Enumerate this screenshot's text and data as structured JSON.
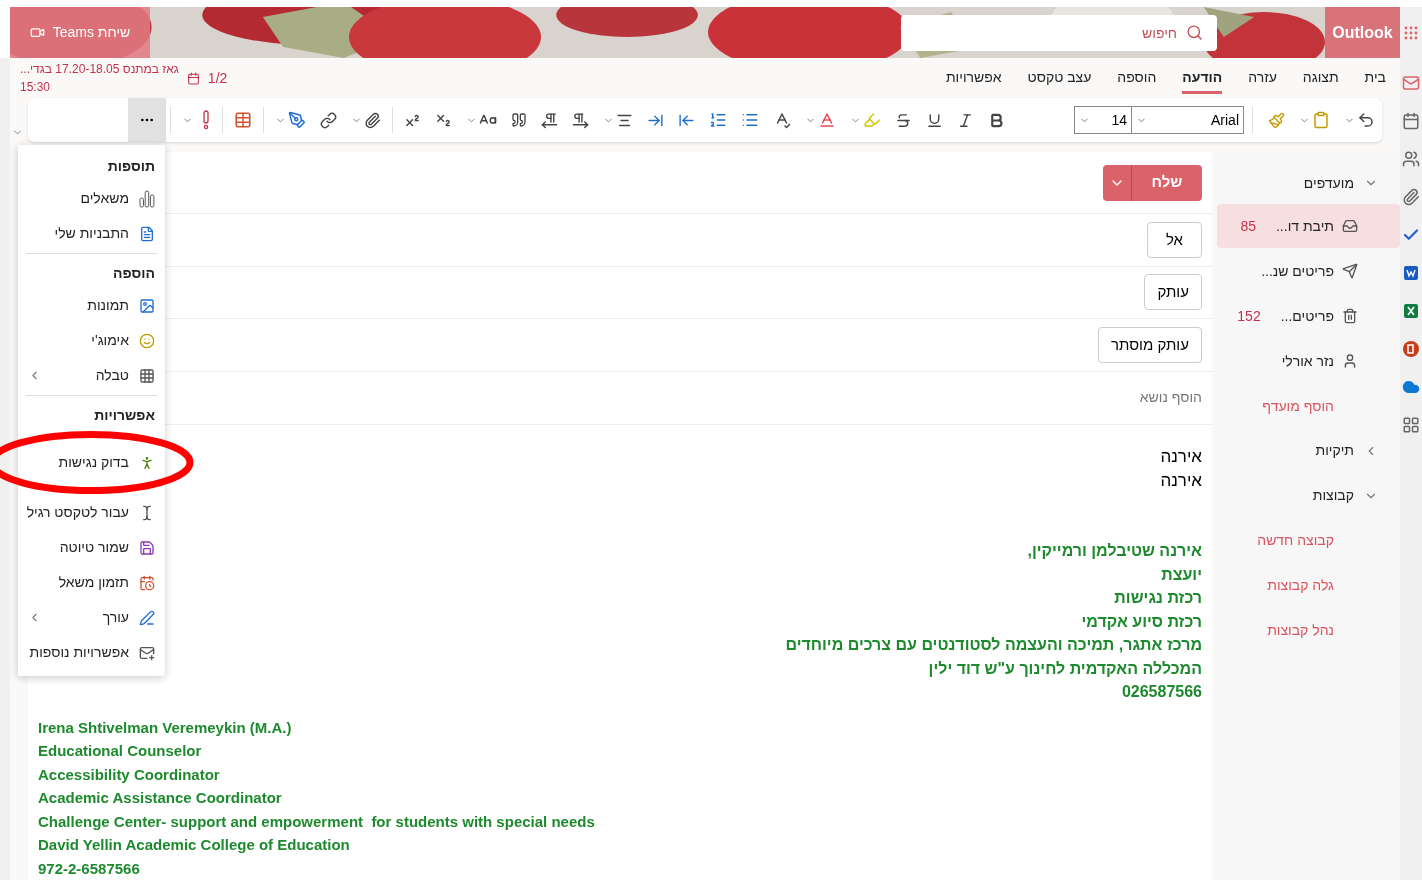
{
  "header": {
    "teams_button": {
      "label": "שיחת Teams"
    },
    "search": {
      "placeholder": "חיפוש"
    },
    "app_name": "Outlook"
  },
  "reminder": {
    "title": "גאז במתנס 17.20-18.05 בגדי...",
    "time": "15:30",
    "count": "1/2"
  },
  "tabs": [
    {
      "label": "בית",
      "selected": false
    },
    {
      "label": "תצוגה",
      "selected": false
    },
    {
      "label": "עזרה",
      "selected": false
    },
    {
      "label": "הודעה",
      "selected": true
    },
    {
      "label": "הוספה",
      "selected": false
    },
    {
      "label": "עצב טקסט",
      "selected": false
    },
    {
      "label": "אפשרויות",
      "selected": false
    }
  ],
  "toolbar": {
    "font": "Arial",
    "size": "14",
    "more_expanded": true
  },
  "menu": [
    {
      "title": "תוספות",
      "items": [
        {
          "label": "משאלים",
          "submenu": false
        },
        {
          "label": "התבניות שלי",
          "submenu": false
        }
      ]
    },
    {
      "title": "הוספה",
      "items": [
        {
          "label": "תמונות",
          "submenu": false
        },
        {
          "label": "אימוג'י",
          "submenu": false
        },
        {
          "label": "טבלה",
          "submenu": true
        }
      ]
    },
    {
      "title": "אפשרויות",
      "items": [
        {
          "label": "בדוק נגישות",
          "submenu": false,
          "circled": true
        },
        {
          "label": "עבור לטקסט רגיל",
          "submenu": false,
          "circled": false
        },
        {
          "label": "שמור טיוטה",
          "submenu": false
        },
        {
          "label": "תזמון משאל",
          "submenu": false
        },
        {
          "label": "עורך",
          "submenu": true
        },
        {
          "label": "אפשרויות נוספות",
          "submenu": false
        }
      ]
    }
  ],
  "compose": {
    "send": "שלח",
    "to": "אל",
    "cc": "עותק",
    "bcc": "עותק מוסתר",
    "subject": {
      "placeholder": "הוסף נושא"
    },
    "body": [
      "אירנה",
      "אירנה"
    ],
    "signature_he": [
      "אירנה שטיבלמן ורמייקין,",
      "יועצת",
      "רכזת נגישות",
      "רכזת סיוע אקדמי",
      "מרכז אתגר, תמיכה והעצמה לסטודנטים עם צרכים מיוחדים",
      "המכללה האקדמית לחינוך ע\"ש דוד ילין",
      "026587566"
    ],
    "signature_en": [
      "Irena Shtivelman Veremeykin (M.A.)",
      "Educational Counselor",
      "Accessibility Coordinator",
      "Academic Assistance Coordinator",
      "Challenge Center- support and empowerment  for students with special needs",
      "David Yellin Academic College of Education",
      "972-2-6587566"
    ]
  },
  "nav": {
    "favorites": {
      "label": "מועדפים",
      "expanded": true
    },
    "items": [
      {
        "label": "תיבת דו...",
        "count": "85",
        "selected": true
      },
      {
        "label": "פריטים שנ...",
        "selected": false
      },
      {
        "label": "פריטים...",
        "count": "152",
        "selected": false
      },
      {
        "label": "נזר אורלי",
        "selected": false
      }
    ],
    "add_favorite": "הוסף מועדף",
    "folders": {
      "label": "תיקיות",
      "expanded": false
    },
    "groups": {
      "label": "קבוצות",
      "expanded": true
    },
    "group_links": [
      "קבוצה חדשה",
      "גלה קבוצות",
      "נהל קבוצות"
    ]
  },
  "app_rail": [
    {
      "selected": true
    },
    {
      "selected": false
    },
    {
      "selected": false
    },
    {
      "selected": false
    },
    {
      "selected": false
    },
    {
      "selected": false
    },
    {
      "selected": false
    },
    {
      "selected": false
    },
    {
      "selected": false
    },
    {
      "selected": false
    }
  ]
}
